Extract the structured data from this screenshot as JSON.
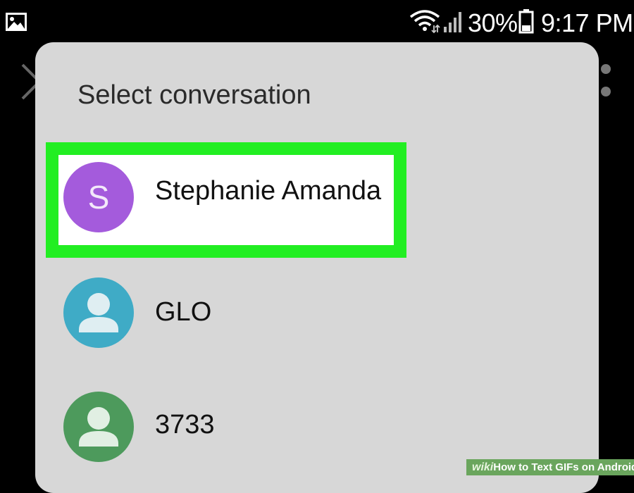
{
  "status_bar": {
    "battery_percent": "30%",
    "time": "9:17 PM",
    "icons": [
      "gallery-icon",
      "wifi-icon",
      "signal-icon",
      "battery-icon"
    ]
  },
  "background_app": {
    "icons": [
      "back-chevron-icon",
      "more-options-icon"
    ]
  },
  "dialog": {
    "title": "Select conversation",
    "conversations": [
      {
        "name": "Stephanie Amanda",
        "avatar_letter": "S",
        "avatar_color": "#a45bdc",
        "highlighted": true
      },
      {
        "name": "GLO",
        "avatar_icon": "person-icon",
        "avatar_color": "#3fabc6"
      },
      {
        "name": "3733",
        "avatar_icon": "person-icon",
        "avatar_color": "#4d9a5c"
      }
    ],
    "highlight_color": "#22ee22"
  },
  "watermark": {
    "prefix": "wiki",
    "text": "How to Text GIFs on Android"
  }
}
